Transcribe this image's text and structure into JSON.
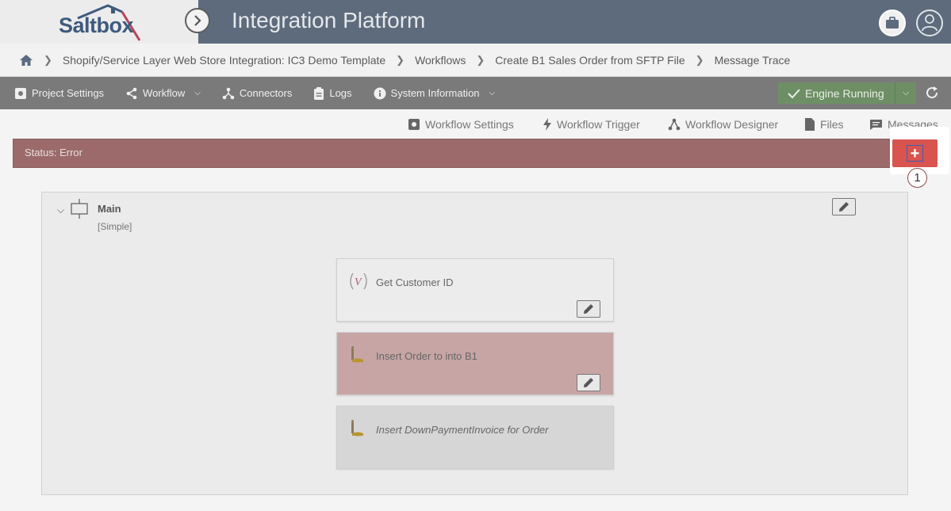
{
  "header": {
    "logo_text": "Saltbox",
    "app_title": "Integration Platform"
  },
  "breadcrumb": {
    "items": [
      "Shopify/Service Layer Web Store Integration: IC3 Demo Template",
      "Workflows",
      "Create B1 Sales Order from SFTP File",
      "Message Trace"
    ]
  },
  "menubar": {
    "items": [
      {
        "label": "Project Settings",
        "icon": "gear-icon"
      },
      {
        "label": "Workflow",
        "icon": "share-icon",
        "dropdown": true
      },
      {
        "label": "Connectors",
        "icon": "connectors-icon"
      },
      {
        "label": "Logs",
        "icon": "clipboard-icon"
      },
      {
        "label": "System Information",
        "icon": "info-icon",
        "dropdown": true
      }
    ],
    "engine_label": "Engine Running",
    "engine_color": "#6e8f66"
  },
  "submenu": {
    "items": [
      {
        "label": "Workflow Settings",
        "icon": "gear-icon"
      },
      {
        "label": "Workflow Trigger",
        "icon": "lightning-icon"
      },
      {
        "label": "Workflow Designer",
        "icon": "designer-icon"
      },
      {
        "label": "Files",
        "icon": "file-icon"
      },
      {
        "label": "Messages",
        "icon": "message-icon"
      }
    ]
  },
  "status": {
    "text": "Status: Error",
    "color": "#d9534f",
    "step_number": "1"
  },
  "workflow": {
    "title": "Main",
    "subtitle": "[Simple]",
    "steps": [
      {
        "label": "Get Customer ID",
        "state": "normal"
      },
      {
        "label": "Insert Order to into B1",
        "state": "error"
      },
      {
        "label": "Insert DownPaymentInvoice for Order",
        "state": "disabled"
      }
    ]
  }
}
